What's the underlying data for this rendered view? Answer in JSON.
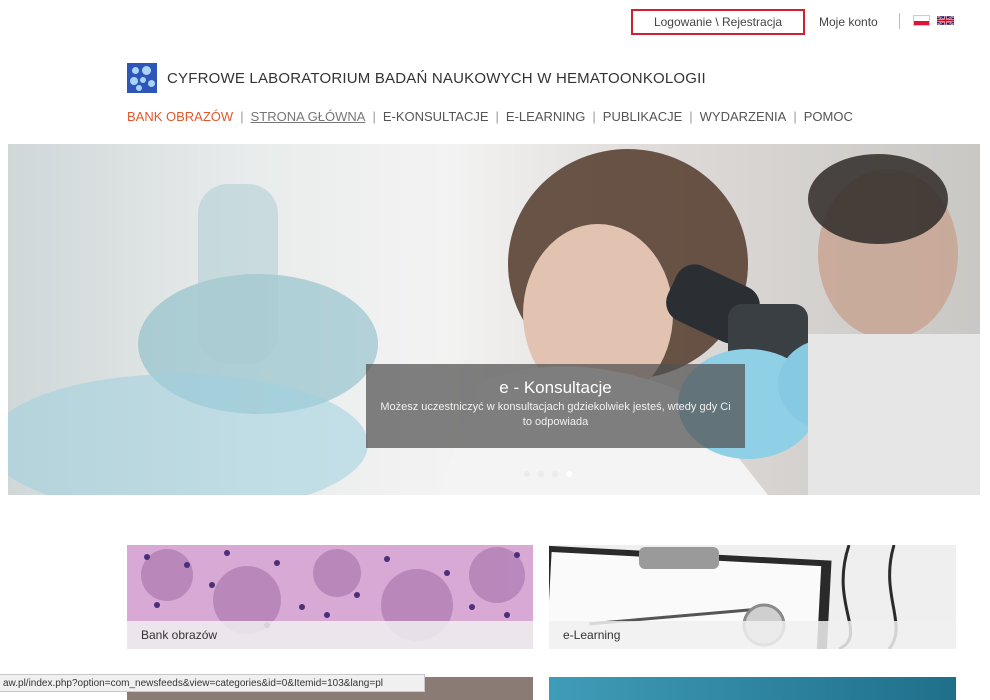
{
  "topbar": {
    "login_label": "Logowanie \\ Rejestracja",
    "account_label": "Moje konto",
    "flags": [
      "flag-pl-icon",
      "flag-uk-icon"
    ]
  },
  "brand": {
    "title": "CYFROWE LABORATORIUM BADAŃ NAUKOWYCH W HEMATOONKOLOGII"
  },
  "nav": {
    "items": [
      {
        "label": "BANK OBRAZÓW"
      },
      {
        "label": "STRONA GŁÓWNA"
      },
      {
        "label": "E-KONSULTACJE"
      },
      {
        "label": "E-LEARNING"
      },
      {
        "label": "PUBLIKACJE"
      },
      {
        "label": "WYDARZENIA"
      },
      {
        "label": "POMOC"
      }
    ]
  },
  "hero": {
    "title": "e - Konsultacje",
    "text": "Możesz uczestniczyć w konsultacjach gdziekolwiek jesteś, wtedy gdy Ci to odpowiada",
    "slide_count": 4,
    "active_slide": 4
  },
  "tiles": [
    {
      "label": "Bank obrazów"
    },
    {
      "label": "e-Learning"
    }
  ],
  "status_url": "aw.pl/index.php?option=com_newsfeeds&view=categories&id=0&Itemid=103&lang=pl",
  "colors": {
    "accent": "#e2582a",
    "login_border": "#d1202f",
    "logo_bg": "#2d56b8"
  }
}
